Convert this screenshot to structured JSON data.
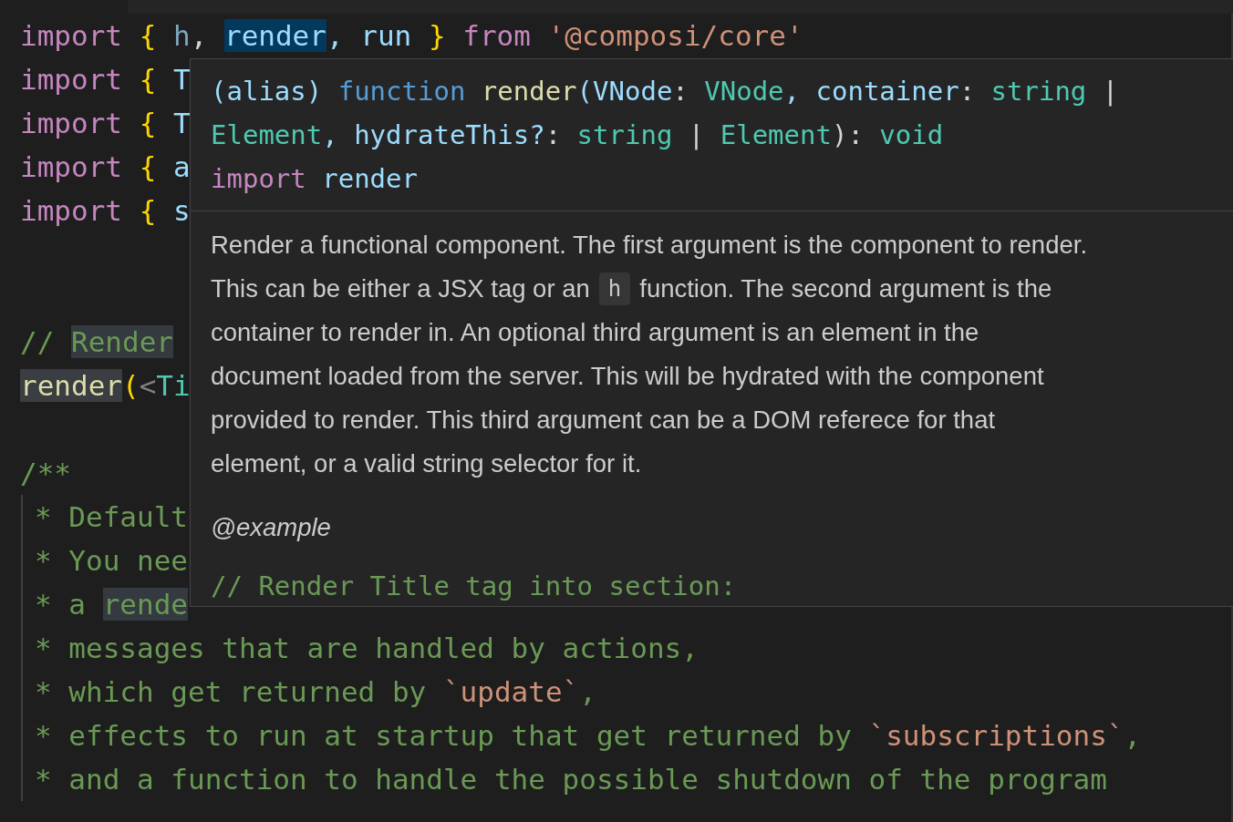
{
  "editor": {
    "lines": [
      {
        "kind": "code",
        "tokens": [
          {
            "t": "import",
            "kind": "kw"
          },
          {
            "t": " {",
            "kind": "brace"
          },
          {
            "t": " h",
            "kind": "dim"
          },
          {
            "t": ", ",
            "kind": "punct"
          },
          {
            "t": "render",
            "kind": "selection"
          },
          {
            "t": ", run",
            "kind": "var"
          },
          {
            "t": " }",
            "kind": "brace"
          },
          {
            "t": " from",
            "kind": "kw"
          },
          {
            "t": " '@composi/core'",
            "kind": "str"
          }
        ]
      },
      {
        "kind": "code",
        "tokens": [
          {
            "t": "import",
            "kind": "kw"
          },
          {
            "t": " {",
            "kind": "brace"
          },
          {
            "t": " T",
            "kind": "var"
          }
        ]
      },
      {
        "kind": "code",
        "tokens": [
          {
            "t": "import",
            "kind": "kw"
          },
          {
            "t": " {",
            "kind": "brace"
          },
          {
            "t": " T",
            "kind": "var"
          }
        ]
      },
      {
        "kind": "code",
        "tokens": [
          {
            "t": "import",
            "kind": "kw"
          },
          {
            "t": " {",
            "kind": "brace"
          },
          {
            "t": " a",
            "kind": "var"
          }
        ]
      },
      {
        "kind": "code",
        "tokens": [
          {
            "t": "import",
            "kind": "kw"
          },
          {
            "t": " {",
            "kind": "brace"
          },
          {
            "t": " s",
            "kind": "var"
          }
        ]
      },
      {
        "kind": "blank"
      },
      {
        "kind": "blank"
      },
      {
        "kind": "code",
        "tokens": [
          {
            "t": "// ",
            "kind": "comment"
          },
          {
            "t": "Render",
            "kind": "commentmatch"
          }
        ]
      },
      {
        "kind": "code",
        "tokens": [
          {
            "t": "render",
            "kind": "fnmatch"
          },
          {
            "t": "(",
            "kind": "brace"
          },
          {
            "t": "<",
            "kind": "tag"
          },
          {
            "t": "Ti",
            "kind": "type"
          }
        ]
      },
      {
        "kind": "blank"
      },
      {
        "kind": "code",
        "tokens": [
          {
            "t": "/**",
            "kind": "comment"
          }
        ]
      },
      {
        "kind": "guide",
        "tokens": [
          {
            "t": "* Default",
            "kind": "comment"
          }
        ]
      },
      {
        "kind": "guide",
        "tokens": [
          {
            "t": "* You nee",
            "kind": "comment"
          }
        ]
      },
      {
        "kind": "guide",
        "tokens": [
          {
            "t": "* a ",
            "kind": "comment"
          },
          {
            "t": "rende",
            "kind": "commentmatch"
          }
        ]
      },
      {
        "kind": "guide",
        "tokens": [
          {
            "t": "* messages that are handled by actions,",
            "kind": "comment"
          }
        ]
      },
      {
        "kind": "guide",
        "tokens": [
          {
            "t": "* which get returned by ",
            "kind": "comment"
          },
          {
            "t": "`update`",
            "kind": "str"
          },
          {
            "t": ",",
            "kind": "comment"
          }
        ]
      },
      {
        "kind": "guide",
        "tokens": [
          {
            "t": "* effects to run at startup that get returned by ",
            "kind": "comment"
          },
          {
            "t": "`subscriptions`",
            "kind": "str"
          },
          {
            "t": ",",
            "kind": "comment"
          }
        ]
      },
      {
        "kind": "guide",
        "tokens": [
          {
            "t": "* and a function to handle the possible shutdown of the program",
            "kind": "comment"
          }
        ]
      }
    ]
  },
  "hover": {
    "signature": [
      [
        {
          "t": "(alias)",
          "kind": "var"
        },
        {
          "t": " function",
          "kind": "storage"
        },
        {
          "t": " render",
          "kind": "fn"
        },
        {
          "t": "(VNode",
          "kind": "var"
        },
        {
          "t": ": ",
          "kind": "punct"
        },
        {
          "t": "VNode",
          "kind": "type"
        },
        {
          "t": ", container",
          "kind": "var"
        },
        {
          "t": ": ",
          "kind": "punct"
        },
        {
          "t": "string",
          "kind": "type"
        },
        {
          "t": " |",
          "kind": "punct"
        }
      ],
      [
        {
          "t": "Element",
          "kind": "type"
        },
        {
          "t": ", hydrateThis?",
          "kind": "var"
        },
        {
          "t": ": ",
          "kind": "punct"
        },
        {
          "t": "string",
          "kind": "type"
        },
        {
          "t": " | ",
          "kind": "punct"
        },
        {
          "t": "Element",
          "kind": "type"
        },
        {
          "t": "): ",
          "kind": "punct"
        },
        {
          "t": "void",
          "kind": "type"
        }
      ],
      [
        {
          "t": "import",
          "kind": "kw"
        },
        {
          "t": " render",
          "kind": "var"
        }
      ]
    ],
    "doc_lines": [
      [
        {
          "t": "Render a functional component. The first argument is the component to render.",
          "kind": "text"
        }
      ],
      [
        {
          "t": "This can be either a JSX tag or an",
          "kind": "text"
        },
        {
          "t": "h",
          "kind": "code"
        },
        {
          "t": "function. The second argument is the",
          "kind": "text"
        }
      ],
      [
        {
          "t": "container to render in. An optional third argument is an element in the",
          "kind": "text"
        }
      ],
      [
        {
          "t": "document loaded from the server. This will be hydrated with the component",
          "kind": "text"
        }
      ],
      [
        {
          "t": "provided to render. This third argument can be a DOM referece for that",
          "kind": "text"
        }
      ],
      [
        {
          "t": "element, or a valid string selector for it.",
          "kind": "text"
        }
      ]
    ],
    "tag": "@example",
    "example": "// Render Title tag into section:"
  }
}
